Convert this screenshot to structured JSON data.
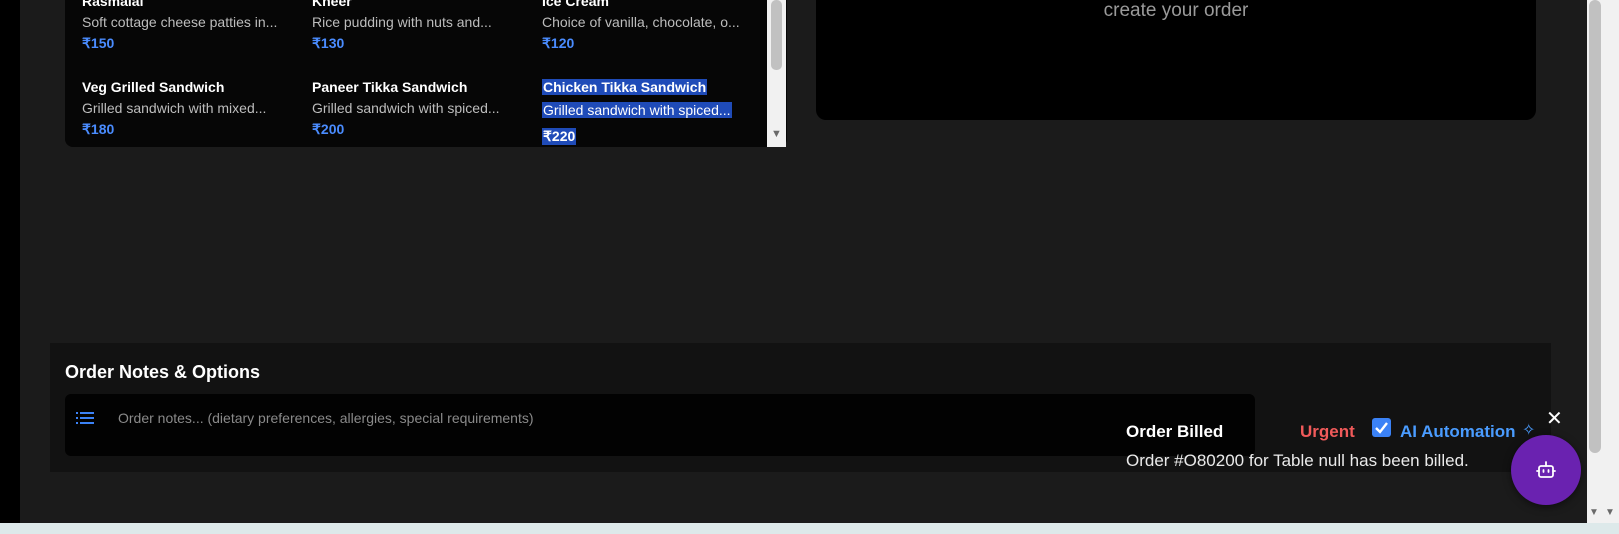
{
  "menu": {
    "items": [
      {
        "name": "Rasmalai",
        "desc": "Soft cottage cheese patties in...",
        "price": "₹150"
      },
      {
        "name": "Kheer",
        "desc": "Rice pudding with nuts and...",
        "price": "₹130"
      },
      {
        "name": "Ice Cream",
        "desc": "Choice of vanilla, chocolate, o...",
        "price": "₹120"
      },
      {
        "name": "Veg Grilled Sandwich",
        "desc": "Grilled sandwich with mixed...",
        "price": "₹180"
      },
      {
        "name": "Paneer Tikka Sandwich",
        "desc": "Grilled sandwich with spiced...",
        "price": "₹200"
      },
      {
        "name": "Chicken Tikka Sandwich",
        "desc": "Grilled sandwich with spiced...",
        "price": "₹220"
      }
    ]
  },
  "order_panel": {
    "hint": "create your order"
  },
  "notes": {
    "title": "Order Notes & Options",
    "placeholder": "Order notes... (dietary preferences, allergies, special requirements)",
    "value": ""
  },
  "toast": {
    "title": "Order Billed",
    "message": "Order #O80200 for Table null has been billed.",
    "close": "✕"
  },
  "options": {
    "urgent_label": "Urgent",
    "ai_automation_label": "AI Automation",
    "ai_automation_checked": true
  },
  "icons": {
    "notes": "list-icon",
    "sparkle": "sparkle-icon",
    "bot": "robot-icon",
    "close": "close-icon"
  },
  "colors": {
    "accent_blue": "#4a8cff",
    "urgent_red": "#f05a5a",
    "bot_purple": "#6a22b0",
    "selection": "#1f4bb8"
  }
}
